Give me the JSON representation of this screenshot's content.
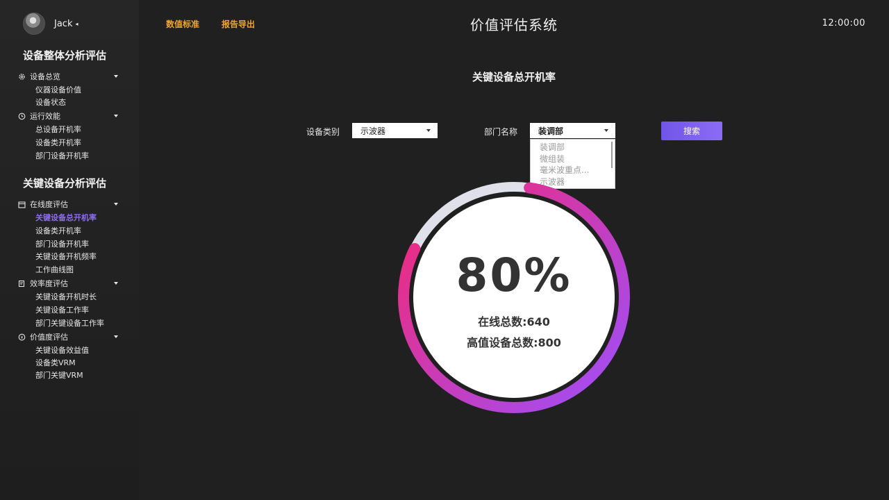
{
  "user": {
    "name": "Jack",
    "caret": "◂"
  },
  "header": {
    "nav": [
      "数值标准",
      "报告导出"
    ],
    "title": "价值评估系统",
    "clock": "12:00:00"
  },
  "sidebar": {
    "section1": "设备整体分析评估",
    "groups1": [
      {
        "label": "设备总览",
        "icon": "gear-icon",
        "items": [
          "仪器设备价值",
          "设备状态"
        ]
      },
      {
        "label": "运行效能",
        "icon": "clock-icon",
        "items": [
          "总设备开机率",
          "设备类开机率",
          "部门设备开机率"
        ]
      }
    ],
    "section2": "关键设备分析评估",
    "groups2": [
      {
        "label": "在线度评估",
        "icon": "calendar-icon",
        "items": [
          "关键设备总开机率",
          "设备类开机率",
          "部门设备开机率",
          "关键设备开机频率",
          "工作曲线图"
        ]
      },
      {
        "label": "效率度评估",
        "icon": "edit-icon",
        "items": [
          "关键设备开机时长",
          "关键设备工作率",
          "部门关键设备工作率"
        ]
      },
      {
        "label": "价值度评估",
        "icon": "coin-icon",
        "items": [
          "关键设备效益值",
          "设备类VRM",
          "部门关键VRM"
        ]
      }
    ],
    "active_item": "关键设备总开机率"
  },
  "main": {
    "heading": "关键设备总开机率",
    "filters": {
      "category_label": "设备类别",
      "category_value": "示波器",
      "dept_label": "部门名称",
      "dept_value": "装调部",
      "dept_options": [
        "装调部",
        "微组装",
        "毫米波重点...",
        "示波器"
      ]
    },
    "search_label": "搜索",
    "gauge": {
      "value_text": "80%",
      "percent": 80,
      "online_label": "在线总数",
      "online_value": "640",
      "total_label": "高值设备总数",
      "total_value": "800",
      "line1": "在线总数:640",
      "line2": "高值设备总数:800"
    }
  },
  "colors": {
    "accent": "#8b6cf5",
    "nav_orange": "#f0a428",
    "gauge_start": "#a54cf0",
    "gauge_end": "#f02a7a",
    "gauge_track": "#e0e0ea"
  }
}
